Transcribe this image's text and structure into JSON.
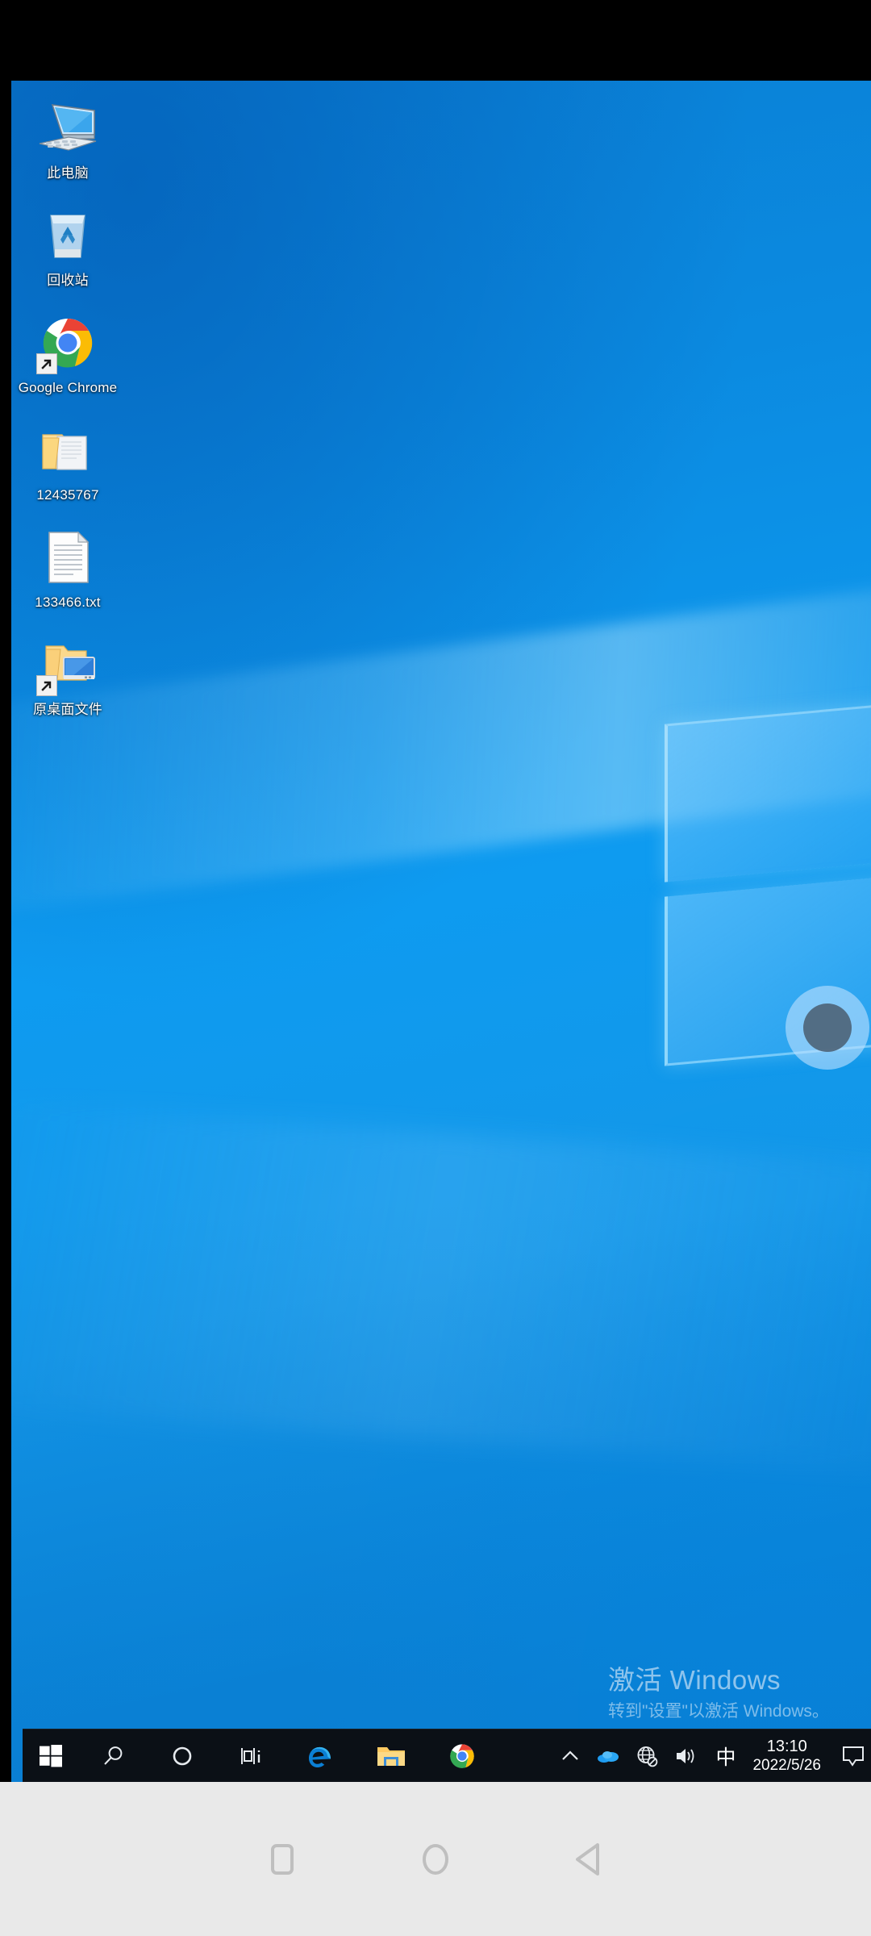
{
  "os": {
    "name": "Windows 10",
    "accent_color": "#0a8ae0",
    "taskbar_color": "#0b1016"
  },
  "desktop": {
    "icons": [
      {
        "label": "此电脑",
        "icon": "this-pc-icon",
        "shortcut": false
      },
      {
        "label": "回收站",
        "icon": "recycle-bin-icon",
        "shortcut": false
      },
      {
        "label": "Google Chrome",
        "icon": "google-chrome-icon",
        "shortcut": true
      },
      {
        "label": "12435767",
        "icon": "folder-open-document-icon",
        "shortcut": false
      },
      {
        "label": "133466.txt",
        "icon": "text-file-icon",
        "shortcut": false
      },
      {
        "label": "原桌面文件",
        "icon": "folder-monitor-shortcut-icon",
        "shortcut": true
      }
    ]
  },
  "watermark": {
    "title": "激活 Windows",
    "subtitle": "转到\"设置\"以激活 Windows。"
  },
  "taskbar": {
    "buttons": [
      {
        "name": "start-button",
        "icon": "windows-logo-icon",
        "label": "开始"
      },
      {
        "name": "search-button",
        "icon": "search-icon",
        "label": "搜索"
      },
      {
        "name": "cortana-button",
        "icon": "cortana-circle-icon",
        "label": "Cortana"
      },
      {
        "name": "task-view-button",
        "icon": "task-view-icon",
        "label": "任务视图"
      },
      {
        "name": "edge-button",
        "icon": "edge-icon",
        "label": "Microsoft Edge"
      },
      {
        "name": "file-explorer-button",
        "icon": "file-explorer-icon",
        "label": "文件资源管理器"
      },
      {
        "name": "chrome-button",
        "icon": "google-chrome-icon",
        "label": "Google Chrome"
      }
    ],
    "tray": [
      {
        "name": "show-hidden-icons-button",
        "icon": "chevron-up-icon"
      },
      {
        "name": "onedrive-tray-icon",
        "icon": "cloud-icon"
      },
      {
        "name": "network-tray-icon",
        "icon": "globe-no-internet-icon"
      },
      {
        "name": "volume-tray-icon",
        "icon": "speaker-icon"
      }
    ],
    "ime": "中",
    "clock": {
      "time": "13:10",
      "date": "2022/5/26"
    },
    "action_center": {
      "name": "action-center-button",
      "icon": "speech-bubble-icon"
    }
  },
  "android_nav": {
    "buttons": [
      {
        "name": "recents-button",
        "icon": "square-icon"
      },
      {
        "name": "home-button",
        "icon": "circle-icon"
      },
      {
        "name": "back-button",
        "icon": "triangle-left-icon"
      }
    ]
  }
}
